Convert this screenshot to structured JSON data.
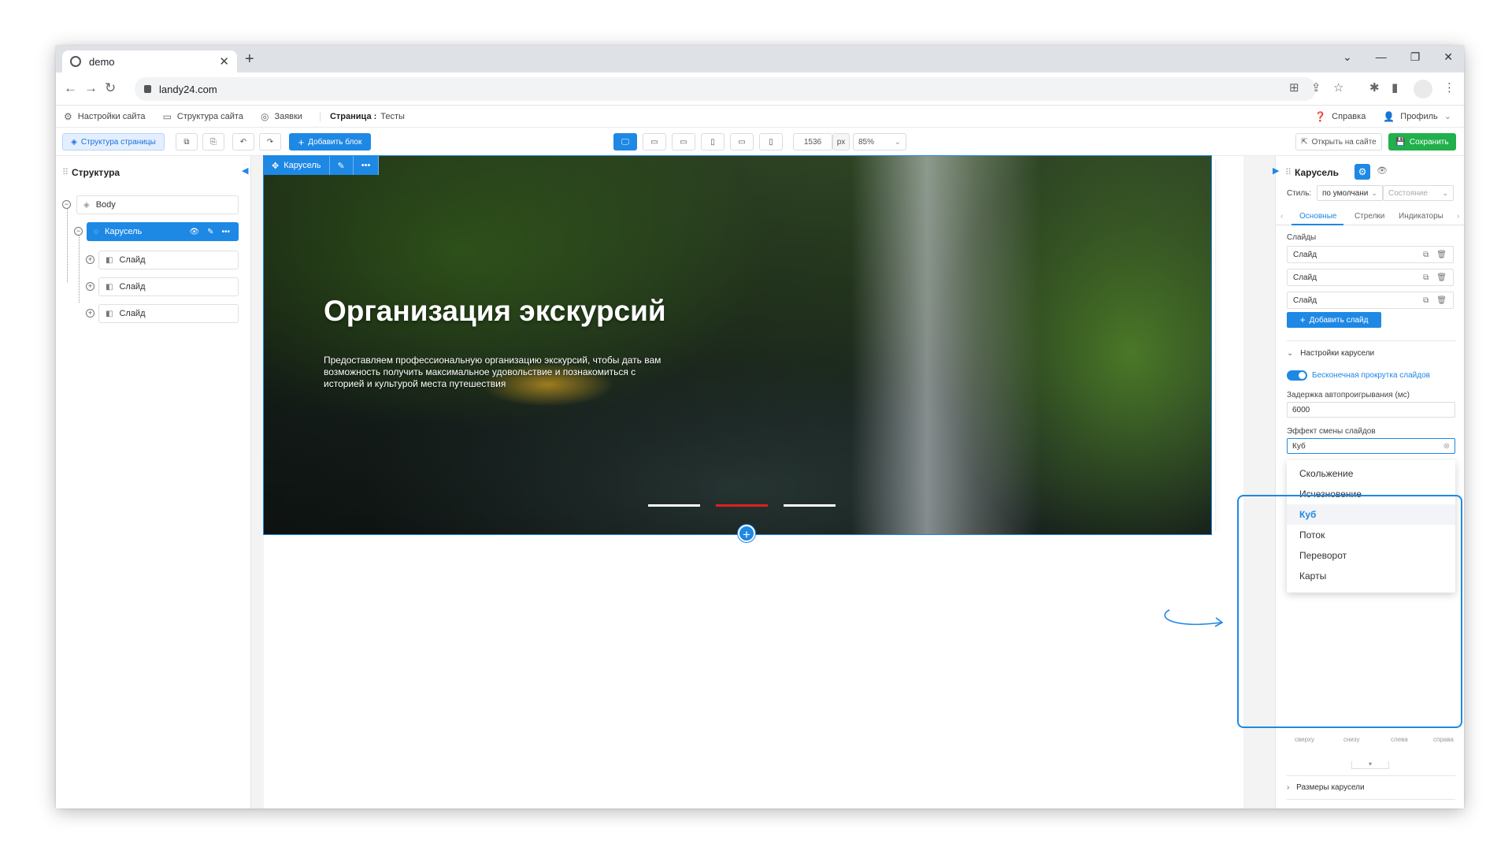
{
  "browser": {
    "tab_title": "demo",
    "url": "landy24.com"
  },
  "menu": {
    "site_settings": "Настройки сайта",
    "site_structure": "Структура сайта",
    "requests": "Заявки",
    "page_label": "Страница :",
    "page_name": "Тесты",
    "help": "Справка",
    "profile": "Профиль"
  },
  "toolbar": {
    "page_structure": "Структура страницы",
    "add_block": "Добавить блок",
    "width_value": "1536",
    "width_unit": "px",
    "zoom": "85%",
    "open_on_site": "Открыть на сайте",
    "save": "Сохранить"
  },
  "left_panel": {
    "title": "Структура",
    "body": "Body",
    "carousel": "Карусель",
    "slides": [
      "Слайд",
      "Слайд",
      "Слайд"
    ]
  },
  "canvas": {
    "block_label": "Карусель",
    "hero_title": "Организация экскурсий",
    "hero_subtitle": "Предоставляем профессиональную организацию экскурсий, чтобы дать вам возможность получить максимальное удовольствие и познакомиться с историей и культурой места путешествия"
  },
  "right_panel": {
    "title": "Карусель",
    "style_label": "Стиль:",
    "style_value": "по умолчани",
    "state_placeholder": "Состояние",
    "tabs": [
      "Основные",
      "Стрелки",
      "Индикаторы"
    ],
    "slides_label": "Слайды",
    "slides": [
      "Слайд",
      "Слайд",
      "Слайд"
    ],
    "add_slide": "Добавить слайд",
    "carousel_settings": "Настройки карусели",
    "infinite_scroll": "Бесконечная прокрутка слайдов",
    "autoplay_label": "Задержка автопроигрывания (мс)",
    "autoplay_value": "6000",
    "effect_label": "Эффект смены слайдов",
    "effect_value": "Куб",
    "effect_options": [
      "Скольжение",
      "Исчезновение",
      "Куб",
      "Поток",
      "Переворот",
      "Карты"
    ],
    "padding_labels": [
      "сверху",
      "снизу",
      "слева",
      "справа"
    ],
    "carousel_sizes": "Размеры карусели"
  },
  "colors": {
    "accent": "#1e88e5",
    "save_green": "#21b04b",
    "active_indicator": "#e02020"
  }
}
